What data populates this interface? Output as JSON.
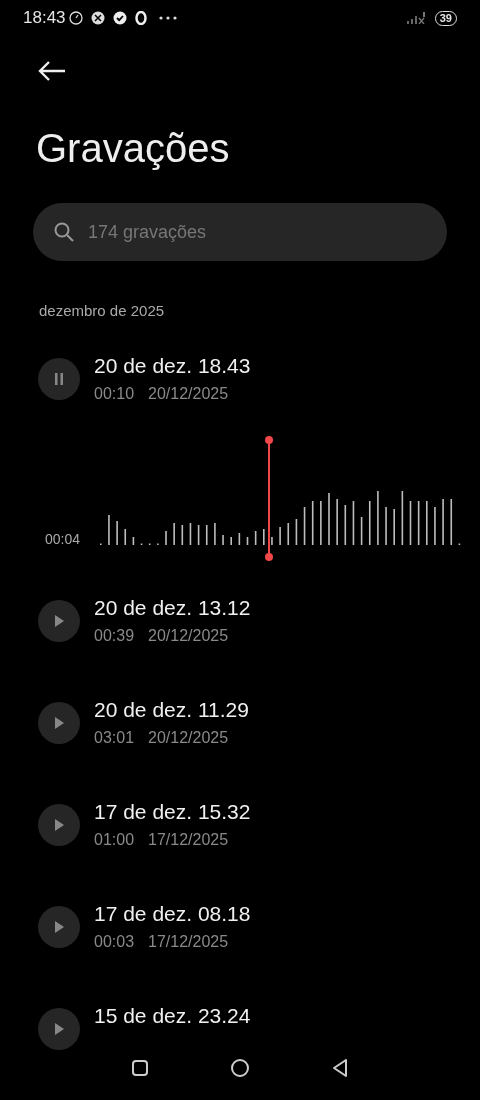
{
  "status_bar": {
    "time": "18:43",
    "battery": "39"
  },
  "title": "Gravações",
  "search": {
    "placeholder": "174 gravações"
  },
  "section": "dezembro de 2025",
  "recordings": [
    {
      "title": "20 de dez. 18.43",
      "duration": "00:10",
      "date": "20/12/2025",
      "playing": true,
      "position": "00:04"
    },
    {
      "title": "20 de dez. 13.12",
      "duration": "00:39",
      "date": "20/12/2025",
      "playing": false
    },
    {
      "title": "20 de dez. 11.29",
      "duration": "03:01",
      "date": "20/12/2025",
      "playing": false
    },
    {
      "title": "17 de dez. 15.32",
      "duration": "01:00",
      "date": "17/12/2025",
      "playing": false
    },
    {
      "title": "17 de dez. 08.18",
      "duration": "00:03",
      "date": "17/12/2025",
      "playing": false
    },
    {
      "title": "15 de dez. 23.24",
      "playing": false
    }
  ]
}
